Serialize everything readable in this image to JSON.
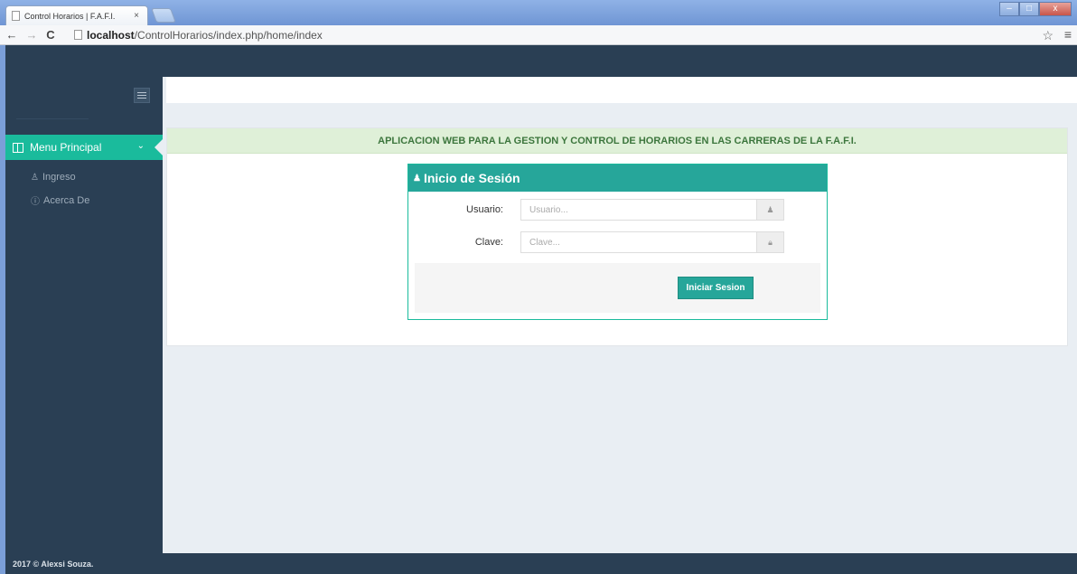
{
  "browser": {
    "tab_title": "Control Horarios | F.A.F.I.",
    "tab_close": "×",
    "url_host": "localhost",
    "url_path": "/ControlHorarios/index.php/home/index",
    "back_glyph": "←",
    "forward_glyph": "→",
    "reload_glyph": "C",
    "star_glyph": "☆",
    "menu_glyph": "≡",
    "min_glyph": "–",
    "max_glyph": "□",
    "close_glyph": "x"
  },
  "sidebar": {
    "menu_main_label": "Menu Principal",
    "items": [
      {
        "icon": "user-icon",
        "glyph": "♙",
        "label": "Ingreso"
      },
      {
        "icon": "info-icon",
        "glyph": "ⓘ",
        "label": "Acerca De"
      }
    ]
  },
  "banner": {
    "text": "APLICACION WEB PARA LA GESTION Y CONTROL DE HORARIOS EN LAS CARRERAS DE LA F.A.F.I."
  },
  "login": {
    "title": "Inicio de Sesión",
    "username_label": "Usuario:",
    "username_placeholder": "Usuario...",
    "password_label": "Clave:",
    "password_placeholder": "Clave...",
    "submit_label": "Iniciar Sesion"
  },
  "footer": {
    "text": "2017 © Alexsi Souza."
  },
  "colors": {
    "sidebar_bg": "#2a3f54",
    "accent": "#1abb9c",
    "login_header": "#26a69a",
    "banner_bg": "#dff0d8",
    "banner_text": "#3c763d"
  }
}
